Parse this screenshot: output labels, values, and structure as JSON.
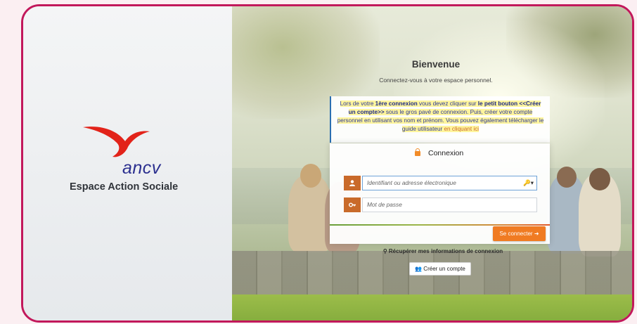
{
  "brand": {
    "logo_text": "ancv",
    "subtitle": "Espace Action Sociale"
  },
  "welcome": {
    "title": "Bienvenue",
    "subtitle": "Connectez-vous à votre espace personnel."
  },
  "info": {
    "part1": "Lors de votre ",
    "part2": "1ère connexion",
    "part3": " vous devez cliquer sur ",
    "part4": "le petit  bouton <<Créer un compte>>",
    "part5": " sous le gros pavé de connexion. Puis, créer votre compte personnel en utilisant vos nom et prénom. Vous pouvez également télécharger le guide utilisateur ",
    "link": "en cliquant ici"
  },
  "login": {
    "title": "Connexion",
    "username_placeholder": "Identifiant ou adresse électronique",
    "username_icons": "🔑▾",
    "password_placeholder": "Mot de passe",
    "connect_label": "Se connecter ➜"
  },
  "footer": {
    "recover_label": "Récupérer mes informations de connexion",
    "create_label": "Créer un compte"
  },
  "colors": {
    "frame": "#c2185b",
    "accent_orange": "#f07b22",
    "addon_brown": "#c96a2a",
    "ancv_red": "#e2231a",
    "ancv_blue": "#2b2f8f"
  },
  "icons": {
    "user": "user-icon",
    "key": "key-icon",
    "lock": "lock-icon",
    "login_arrow": "sign-in-icon",
    "search_key": "key-search-icon",
    "add_user": "user-plus-icon"
  }
}
